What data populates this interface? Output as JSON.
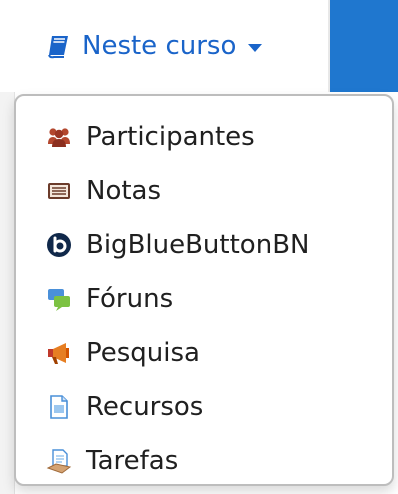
{
  "nav": {
    "course_menu_label": "Neste curso",
    "book_icon": "book-icon",
    "caret_icon": "caret-down-icon"
  },
  "menu": {
    "items": [
      {
        "label": "Participantes",
        "icon": "participants-icon"
      },
      {
        "label": "Notas",
        "icon": "grades-icon"
      },
      {
        "label": "BigBlueButtonBN",
        "icon": "bigbluebutton-icon"
      },
      {
        "label": "Fóruns",
        "icon": "forums-icon"
      },
      {
        "label": "Pesquisa",
        "icon": "survey-icon"
      },
      {
        "label": "Recursos",
        "icon": "resources-icon"
      },
      {
        "label": "Tarefas",
        "icon": "assignments-icon"
      }
    ]
  },
  "colors": {
    "link_blue": "#1a64c9",
    "header_blue": "#1f77cf",
    "text": "#202020"
  }
}
